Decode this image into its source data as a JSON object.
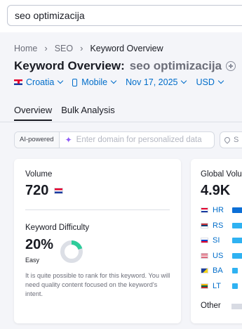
{
  "search": {
    "value": "seo optimizacija"
  },
  "breadcrumb": {
    "items": [
      "Home",
      "SEO",
      "Keyword Overview"
    ]
  },
  "title": {
    "main": "Keyword Overview:",
    "keyword": "seo optimizacija"
  },
  "filters": {
    "country": "Croatia",
    "device": "Mobile",
    "date": "Nov 17, 2025",
    "currency": "USD"
  },
  "tabs": [
    {
      "label": "Overview",
      "active": true
    },
    {
      "label": "Bulk Analysis",
      "active": false
    }
  ],
  "ai": {
    "badge": "AI-powered",
    "placeholder": "Enter domain for personalized data",
    "location_text": "S"
  },
  "volume": {
    "label": "Volume",
    "value": "720"
  },
  "difficulty": {
    "label": "Keyword Difficulty",
    "value": "20%",
    "level": "Easy",
    "percent": 20,
    "description": "It is quite possible to rank for this keyword. You will need quality content focused on the keyword's intent."
  },
  "global": {
    "label": "Global Volu",
    "value": "4.9K",
    "countries": [
      {
        "code": "HR",
        "highlight": true
      },
      {
        "code": "RS"
      },
      {
        "code": "SI"
      },
      {
        "code": "US"
      },
      {
        "code": "BA"
      },
      {
        "code": "LT"
      }
    ],
    "other_label": "Other"
  },
  "colors": {
    "accent": "#006dca",
    "donut_fill": "#2ecc9a",
    "donut_track": "#dcdfe6",
    "bar": "#2fb2f2",
    "bar_highlight": "#0c6fd6"
  }
}
